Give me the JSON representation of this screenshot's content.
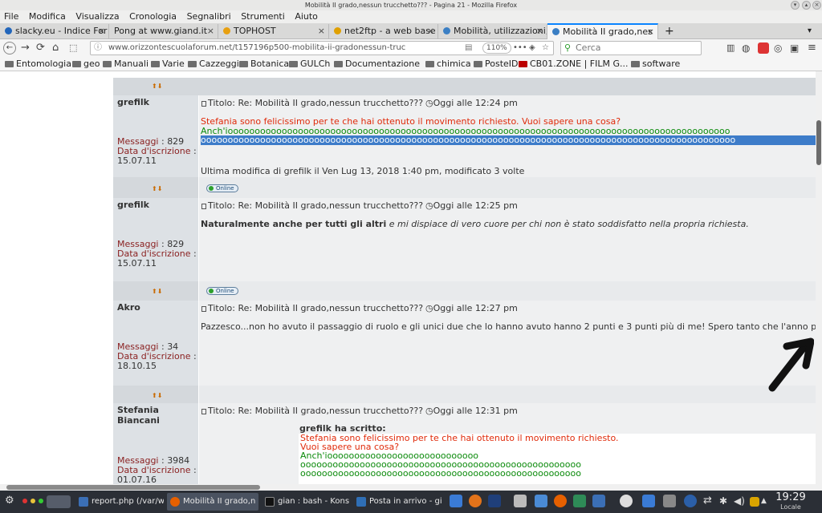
{
  "window": {
    "title": "Mobilità II grado,nessun trucchetto??? - Pagina 21 - Mozilla Firefox"
  },
  "menu": [
    "File",
    "Modifica",
    "Visualizza",
    "Cronologia",
    "Segnalibri",
    "Strumenti",
    "Aiuto"
  ],
  "tabs": [
    {
      "label": "slacky.eu - Indice For",
      "color": "#2266bb"
    },
    {
      "label": "Pong at www.giand.it",
      "color": "#999999"
    },
    {
      "label": "TOPHOST",
      "color": "#e8a010"
    },
    {
      "label": "net2ftp - a web base",
      "color": "#e0a000"
    },
    {
      "label": "Mobilità, utilizzazioni,",
      "color": "#3b7fc4"
    },
    {
      "label": "Mobilità II grado,nes",
      "color": "#3b7fc4"
    }
  ],
  "nav": {
    "url": "www.orizzontescuolaforum.net/t157196p500-mobilita-ii-gradonessun-truc",
    "zoom": "110%",
    "search_placeholder": "Cerca"
  },
  "bookmarks": [
    "Entomologia",
    "geo",
    "Manuali",
    "Varie",
    "Cazzeggi",
    "Botanica",
    "GULCh",
    "Documentazione",
    "chimica",
    "PosteID",
    "CB01.ZONE | FILM G...",
    "software"
  ],
  "online_label": "Online",
  "posts": [
    {
      "author": "grefilk",
      "messages_label": "Messaggi",
      "messages": "829",
      "joined_label": "Data d'iscrizione",
      "joined": "15.07.11",
      "title": "Titolo: Re: Mobilità II grado,nessun trucchetto???",
      "date": "Oggi alle 12:24 pm",
      "line1": "Stefania sono felicissimo per te che hai ottenuto il movimento richiesto. Vuoi sapere una cosa?",
      "line2": "Anch'iooooooooooooooooooooooooooooooooooooooooooooooooooooooooooooooooooooooooooooooooooooooooooooo",
      "line3": "ooooooooooooooooooooooooooooooooooooooooooooooooooooooooooooooooooooooooooooooooooooooooooooooooooo",
      "edit": "Ultima modifica di grefilk il Ven Lug 13, 2018 1:40 pm, modificato 3 volte"
    },
    {
      "author": "grefilk",
      "messages_label": "Messaggi",
      "messages": "829",
      "joined_label": "Data d'iscrizione",
      "joined": "15.07.11",
      "title": "Titolo: Re: Mobilità II grado,nessun trucchetto???",
      "date": "Oggi alle 12:25 pm",
      "bold": "Naturalmente anche per tutti gli altri",
      "italic": "e mi dispiace di vero cuore per chi non è stato soddisfatto nella propria richiesta."
    },
    {
      "author": "Akro",
      "messages_label": "Messaggi",
      "messages": "34",
      "joined_label": "Data d'iscrizione",
      "joined": "18.10.15",
      "title": "Titolo: Re: Mobilità II grado,nessun trucchetto???",
      "date": "Oggi alle 12:27 pm",
      "text": "Pazzesco...non ho avuto il passaggio di ruolo e gli unici due che lo hanno avuto hanno 2 punti e 3 punti più di me! Spero tanto che l'anno prossim"
    },
    {
      "author_line1": "Stefania",
      "author_line2": "Biancani",
      "messages_label": "Messaggi",
      "messages": "3984",
      "joined_label": "Data d'iscrizione",
      "joined": "01.07.16",
      "title": "Titolo: Re: Mobilità II grado,nessun trucchetto???",
      "date": "Oggi alle 12:31 pm",
      "quote_head": "grefilk ha scritto:",
      "q1": "Stefania sono felicissimo per te che hai ottenuto il movimento richiesto.",
      "q2": "Vuoi sapere una cosa?",
      "q3": "Anch'ioooooooooooooooooooooooooooo",
      "q4": "oooooooooooooooooooooooooooooooooooooooooooooooooooo",
      "q5": "oooooooooooooooooooooooooooooooooooooooooooooooooooo"
    }
  ],
  "taskbar": {
    "tasks": [
      {
        "label": "report.php (/var/w",
        "color": "#3b6fb5"
      },
      {
        "label": "Mobilità II grado,n",
        "color": "#e66000"
      },
      {
        "label": "gian : bash - Kons",
        "color": "#333333"
      },
      {
        "label": "Posta in arrivo - gi",
        "color": "#2f6fb6"
      }
    ],
    "time": "19:29",
    "locale": "Locale"
  }
}
